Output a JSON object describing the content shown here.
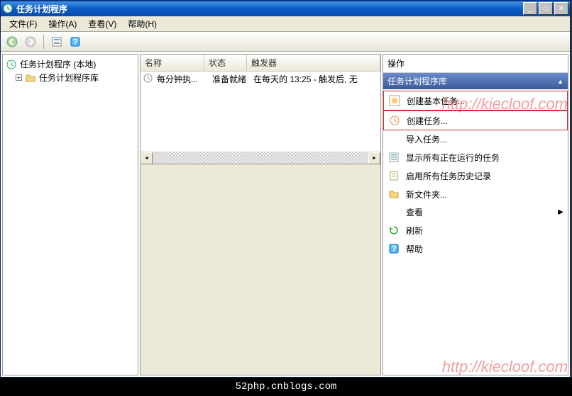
{
  "window": {
    "title": "任务计划程序"
  },
  "menubar": {
    "file": "文件(F)",
    "action": "操作(A)",
    "view": "查看(V)",
    "help": "帮助(H)"
  },
  "tree": {
    "root": "任务计划程序 (本地)",
    "library": "任务计划程序库"
  },
  "list": {
    "headers": {
      "name": "名称",
      "status": "状态",
      "triggers": "触发器"
    },
    "rows": [
      {
        "name": "每分钟执...",
        "status": "准备就绪",
        "triggers": "在每天的 13:25 - 触发后, 无"
      }
    ]
  },
  "actions": {
    "pane_title": "操作",
    "sub_title": "任务计划程序库",
    "items": {
      "create_basic": "创建基本任务...",
      "create_task": "创建任务...",
      "import_task": "导入任务...",
      "show_running": "显示所有正在运行的任务",
      "enable_history": "启用所有任务历史记录",
      "new_folder": "新文件夹...",
      "view": "查看",
      "refresh": "刷新",
      "help": "帮助"
    }
  },
  "footer_text": "52php.cnblogs.com",
  "watermark": "http://kiecloof.com"
}
